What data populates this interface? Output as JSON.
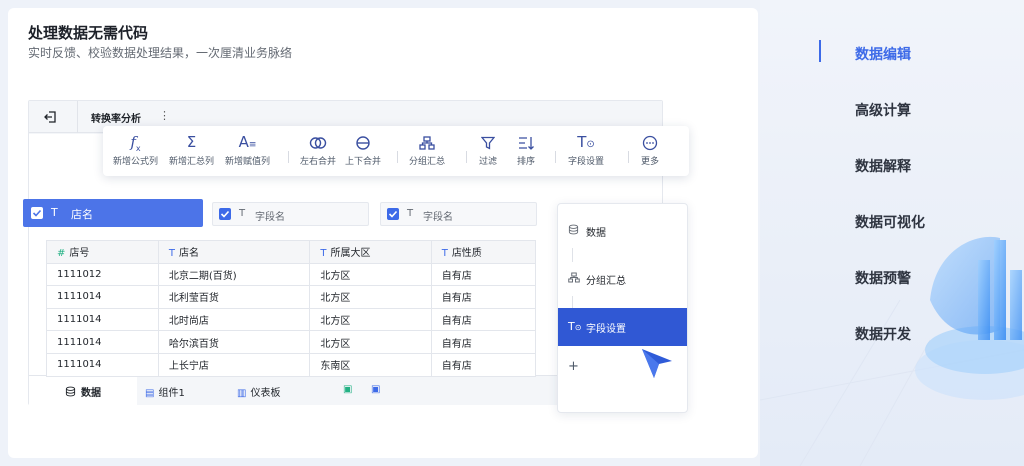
{
  "card": {
    "title": "处理数据无需代码",
    "subtitle": "实时反馈、校验数据处理结果，一次厘清业务脉络"
  },
  "app": {
    "tab_name": "转换率分析",
    "tab_more": "⋮",
    "toolbar": [
      {
        "icon": "function-icon",
        "label": "新增公式列"
      },
      {
        "icon": "sigma-icon",
        "label": "新增汇总列"
      },
      {
        "icon": "assign-icon",
        "label": "新增赋值列"
      },
      {
        "icon": "merge-lr-icon",
        "label": "左右合并"
      },
      {
        "icon": "merge-ud-icon",
        "label": "上下合并"
      },
      {
        "icon": "group-icon",
        "label": "分组汇总"
      },
      {
        "icon": "filter-icon",
        "label": "过滤"
      },
      {
        "icon": "sort-icon",
        "label": "排序"
      },
      {
        "icon": "field-settings-icon",
        "label": "字段设置"
      },
      {
        "icon": "more-icon",
        "label": "更多"
      }
    ],
    "field_chips": {
      "selected": {
        "type_glyph": "T",
        "label": "店名"
      },
      "others": [
        {
          "type_glyph": "T",
          "label": "字段名"
        },
        {
          "type_glyph": "T",
          "label": "字段名"
        }
      ]
    },
    "table": {
      "headers": [
        {
          "glyph": "#",
          "label": "店号"
        },
        {
          "glyph": "T",
          "label": "店名"
        },
        {
          "glyph": "T",
          "label": "所属大区"
        },
        {
          "glyph": "T",
          "label": "店性质"
        }
      ],
      "rows": [
        [
          "1111012",
          "北京二期(百货)",
          "北方区",
          "自有店"
        ],
        [
          "1111014",
          "北利莹百货",
          "北方区",
          "自有店"
        ],
        [
          "1111014",
          "北时尚店",
          "北方区",
          "自有店"
        ],
        [
          "1111014",
          "哈尔滨百货",
          "北方区",
          "自有店"
        ],
        [
          "1111014",
          "上长宁店",
          "东南区",
          "自有店"
        ]
      ]
    },
    "bottom_tabs": [
      {
        "label": "数据",
        "active": true
      },
      {
        "label": "组件1",
        "active": false
      },
      {
        "label": "仪表板",
        "active": false
      }
    ],
    "flow_nodes": [
      {
        "label": "数据",
        "active": false
      },
      {
        "label": "分组汇总",
        "active": false
      },
      {
        "label": "字段设置",
        "active": true
      }
    ],
    "flow_add": "+"
  },
  "side_menu": [
    {
      "label": "数据编辑",
      "active": true
    },
    {
      "label": "高级计算",
      "active": false
    },
    {
      "label": "数据解释",
      "active": false
    },
    {
      "label": "数据可视化",
      "active": false
    },
    {
      "label": "数据预警",
      "active": false
    },
    {
      "label": "数据开发",
      "active": false
    }
  ],
  "colors": {
    "accent": "#3d6ae8",
    "selected_chip": "#4c74e8",
    "active_node": "#3058d4"
  }
}
